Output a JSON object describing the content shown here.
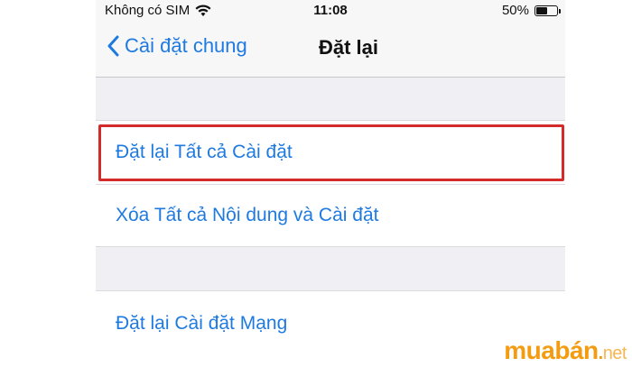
{
  "status_bar": {
    "carrier": "Không có SIM",
    "time": "11:08",
    "battery_percent_label": "50%",
    "battery_level": 0.5
  },
  "nav": {
    "back_label": "Cài đặt chung",
    "title": "Đặt lại"
  },
  "groups": [
    {
      "items": [
        {
          "label": "Đặt lại Tất cả Cài đặt",
          "highlighted": true
        },
        {
          "label": "Xóa Tất cả Nội dung và Cài đặt"
        }
      ]
    },
    {
      "items": [
        {
          "label": "Đặt lại Cài đặt Mạng"
        }
      ]
    }
  ],
  "watermark": {
    "main": "muabán",
    "dot": ".",
    "suffix": "net"
  },
  "colors": {
    "accent": "#1f7ae0",
    "highlight": "#d42a2a",
    "background": "#efeff4",
    "watermark": "#f39c12"
  }
}
